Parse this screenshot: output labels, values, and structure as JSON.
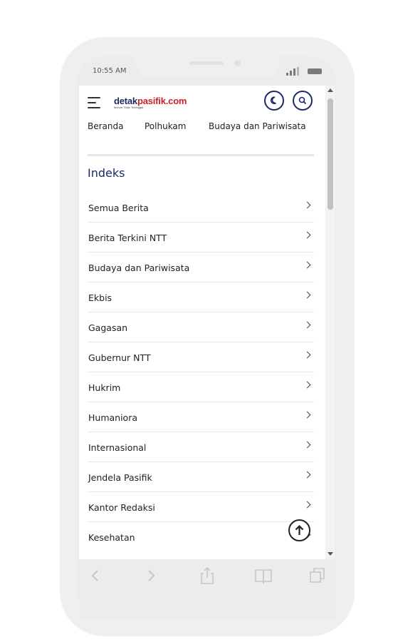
{
  "status_bar": {
    "time": "10:55 AM"
  },
  "header": {
    "logo": {
      "part1": "detak",
      "part2": "pasifik.com",
      "tagline": "Mohon Tidak Tertinggal"
    },
    "dark_mode_icon": "moon-icon",
    "search_icon": "search-icon"
  },
  "nav": {
    "items": [
      "Beranda",
      "Polhukam",
      "Budaya dan Pariwisata"
    ]
  },
  "index": {
    "title": "Indeks",
    "items": [
      "Semua Berita",
      "Berita Terkini NTT",
      "Budaya dan Pariwisata",
      "Ekbis",
      "Gagasan",
      "Gubernur NTT",
      "Hukrim",
      "Humaniora",
      "Internasional",
      "Jendela Pasifik",
      "Kantor Redaksi",
      "Kesehatan"
    ]
  },
  "back_to_top_icon": "arrow-up-icon",
  "browser_toolbar": {
    "icons": [
      "back-icon",
      "forward-icon",
      "share-icon",
      "bookmarks-icon",
      "tabs-icon"
    ]
  },
  "colors": {
    "brand_navy": "#1b2a6b",
    "brand_red": "#c8202d"
  }
}
